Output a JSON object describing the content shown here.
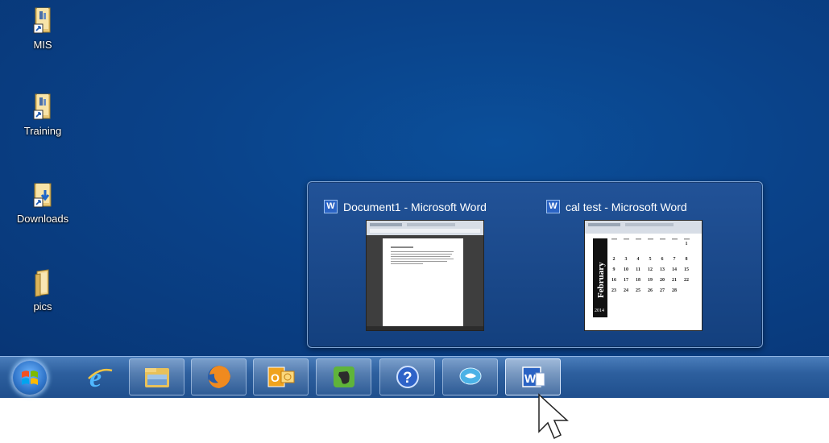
{
  "desktop": {
    "icons": [
      {
        "label": "MIS",
        "icon": "folder-shortcut-icon"
      },
      {
        "label": "Training",
        "icon": "folder-shortcut-icon"
      },
      {
        "label": "Downloads",
        "icon": "downloads-folder-icon"
      },
      {
        "label": "pics",
        "icon": "folder-icon"
      }
    ]
  },
  "preview": {
    "windows": [
      {
        "title": "Document1 - Microsoft Word",
        "app_icon": "W"
      },
      {
        "title": "cal test - Microsoft Word",
        "app_icon": "W",
        "calendar": {
          "month": "February",
          "year": "2014",
          "weeks": [
            [
              "",
              "",
              "",
              "",
              "",
              "",
              "1"
            ],
            [
              "2",
              "3",
              "4",
              "5",
              "6",
              "7",
              "8"
            ],
            [
              "9",
              "10",
              "11",
              "12",
              "13",
              "14",
              "15"
            ],
            [
              "16",
              "17",
              "18",
              "19",
              "20",
              "21",
              "22"
            ],
            [
              "23",
              "24",
              "25",
              "26",
              "27",
              "28",
              ""
            ]
          ]
        }
      }
    ]
  },
  "taskbar": {
    "items": [
      "start-button",
      "internet-explorer",
      "windows-explorer",
      "firefox",
      "outlook",
      "evernote",
      "help",
      "connection-app",
      "microsoft-word"
    ],
    "active": "microsoft-word",
    "colors": {
      "taskbar": "#2d5f9e",
      "desktop": "#0a4289",
      "accent": "#2a63c4"
    }
  }
}
